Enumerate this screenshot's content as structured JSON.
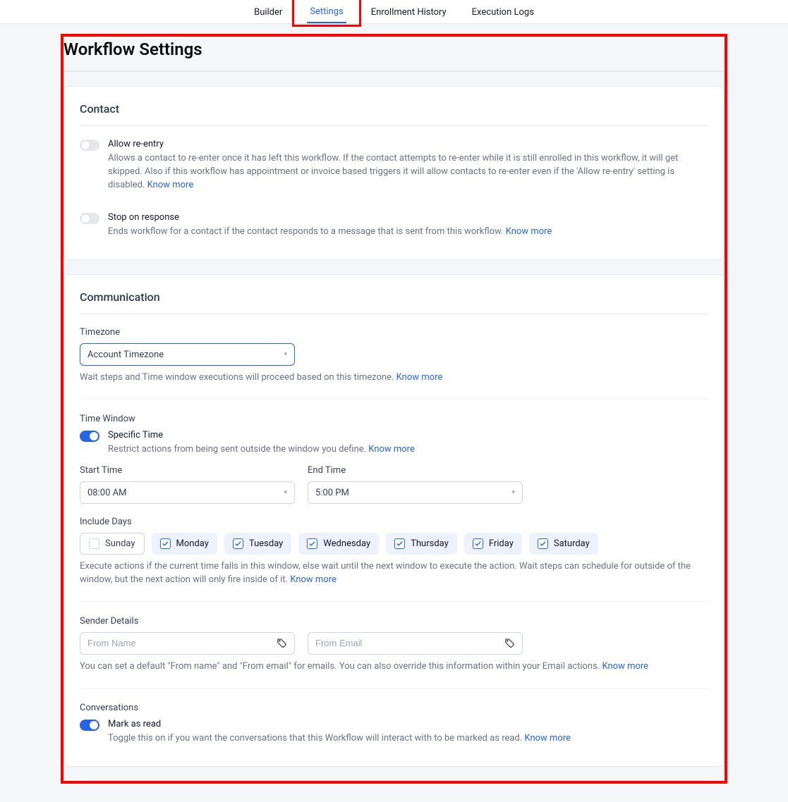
{
  "tabs": {
    "builder": "Builder",
    "settings": "Settings",
    "enrollment": "Enrollment History",
    "logs": "Execution Logs"
  },
  "page_title": "Workflow Settings",
  "contact": {
    "title": "Contact",
    "allow_reentry": {
      "label": "Allow re-entry",
      "desc": "Allows a contact to re-enter once it has left this workflow. If the contact attempts to re-enter while it is still enrolled in this workflow, it will get skipped. Also if this workflow has appointment or invoice based triggers it will allow contacts to re-enter even if the 'Allow re-entry' setting is disabled.",
      "know_more": "Know more",
      "on": false
    },
    "stop_on_response": {
      "label": "Stop on response",
      "desc": "Ends workflow for a contact if the contact responds to a message that is sent from this workflow.",
      "know_more": "Know more",
      "on": false
    }
  },
  "communication": {
    "title": "Communication",
    "timezone": {
      "label": "Timezone",
      "value": "Account Timezone",
      "helper": "Wait steps and Time window executions will proceed based on this timezone.",
      "know_more": "Know more"
    },
    "time_window": {
      "label": "Time Window",
      "specific_label": "Specific Time",
      "specific_desc": "Restrict actions from being sent outside the window you define.",
      "know_more": "Know more",
      "on": true,
      "start_label": "Start Time",
      "start_value": "08:00 AM",
      "end_label": "End Time",
      "end_value": "5:00 PM",
      "include_label": "Include Days",
      "days": [
        {
          "name": "Sunday",
          "checked": false
        },
        {
          "name": "Monday",
          "checked": true
        },
        {
          "name": "Tuesday",
          "checked": true
        },
        {
          "name": "Wednesday",
          "checked": true
        },
        {
          "name": "Thursday",
          "checked": true
        },
        {
          "name": "Friday",
          "checked": true
        },
        {
          "name": "Saturday",
          "checked": true
        }
      ],
      "helper": "Execute actions if the current time falls in this window, else wait until the next window to execute the action. Wait steps can schedule for outside of the window, but the next action will only fire inside of it.",
      "helper_know_more": "Know more"
    },
    "sender": {
      "label": "Sender Details",
      "from_name_placeholder": "From Name",
      "from_email_placeholder": "From Email",
      "helper": "You can set a default \"From name\" and \"From email\" for emails. You can also override this information within your Email actions.",
      "know_more": "Know more"
    },
    "conversations": {
      "label": "Conversations",
      "mark_label": "Mark as read",
      "mark_desc": "Toggle this on if you want the conversations that this Workflow will interact with to be marked as read.",
      "know_more": "Know more",
      "on": true
    }
  }
}
